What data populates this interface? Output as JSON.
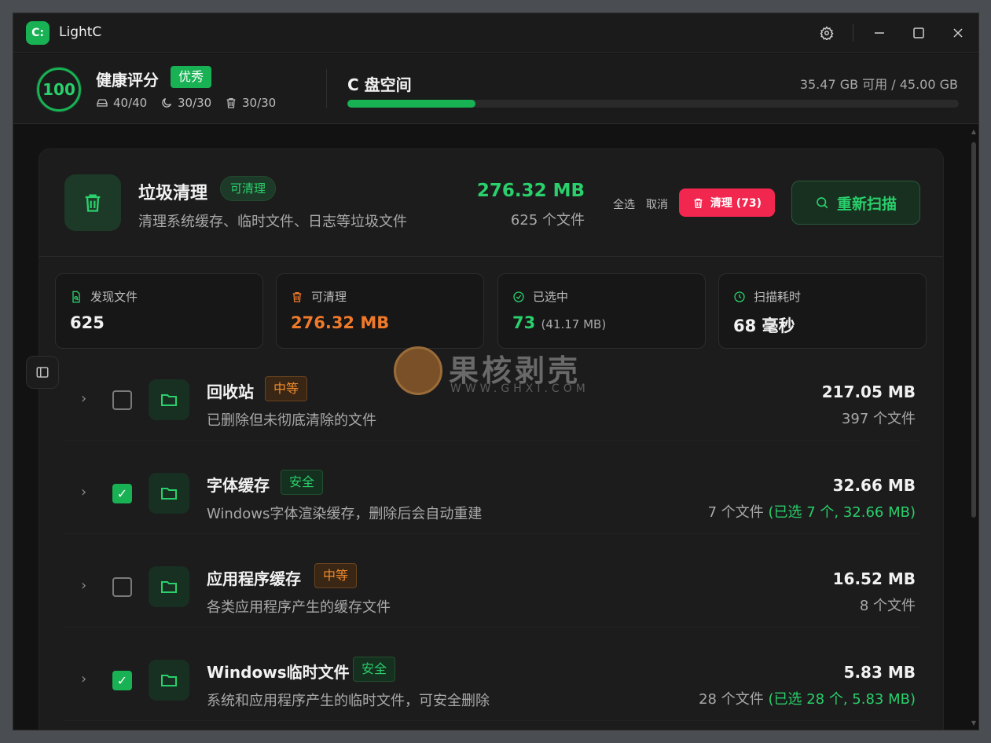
{
  "app": {
    "logo": "C:",
    "title": "LightC"
  },
  "titlebar": {
    "settings_icon": "gear-icon",
    "minimize_icon": "minimize-icon",
    "maximize_icon": "maximize-icon",
    "close_icon": "close-icon"
  },
  "header": {
    "score": "100",
    "health_title": "健康评分",
    "health_badge": "优秀",
    "stats": [
      {
        "icon": "drive-icon",
        "value": "40/40"
      },
      {
        "icon": "moon-icon",
        "value": "30/30"
      },
      {
        "icon": "trash-icon",
        "value": "30/30"
      }
    ],
    "disk_title": "C 盘空间",
    "disk_info": "35.47 GB 可用 / 45.00 GB",
    "disk_used_fraction": 0.21
  },
  "card": {
    "title": "垃圾清理",
    "badge": "可清理",
    "desc": "清理系统缓存、临时文件、日志等垃圾文件",
    "size": "276.32 MB",
    "count": "625 个文件",
    "select_all": "全选",
    "cancel": "取消",
    "clean_label": "清理 (73)",
    "rescan_label": "重新扫描"
  },
  "stats": [
    {
      "icon": "file-search-icon",
      "label": "发现文件",
      "value": "625",
      "sub": "",
      "color": "#f2f2f2"
    },
    {
      "icon": "trash-icon",
      "label": "可清理",
      "value": "276.32 MB",
      "sub": "",
      "color": "#f07a2a"
    },
    {
      "icon": "check-circle-icon",
      "label": "已选中",
      "value": "73",
      "sub": "(41.17 MB)",
      "color": "#29d06b"
    },
    {
      "icon": "clock-icon",
      "label": "扫描耗时",
      "value": "68 毫秒",
      "sub": "",
      "color": "#f2f2f2"
    }
  ],
  "watermark": {
    "text": "果核剥壳",
    "sub": "WWW.GHXI.COM"
  },
  "rows": [
    {
      "name": "回收站",
      "tag": "中等",
      "tag_type": "mid",
      "desc": "已删除但未彻底清除的文件",
      "size": "217.05 MB",
      "count": "397 个文件",
      "selected": "",
      "checked": false
    },
    {
      "name": "字体缓存",
      "tag": "安全",
      "tag_type": "safe",
      "desc": "Windows字体渲染缓存，删除后会自动重建",
      "size": "32.66 MB",
      "count": "7 个文件",
      "selected": "(已选 7 个, 32.66 MB)",
      "checked": true
    },
    {
      "name": "应用程序缓存",
      "tag": "中等",
      "tag_type": "mid",
      "desc": "各类应用程序产生的缓存文件",
      "size": "16.52 MB",
      "count": "8 个文件",
      "selected": "",
      "checked": false
    },
    {
      "name": "Windows临时文件",
      "tag": "安全",
      "tag_type": "safe",
      "desc": "系统和应用程序产生的临时文件，可安全删除",
      "size": "5.83 MB",
      "count": "28 个文件",
      "selected": "(已选 28 个, 5.83 MB)",
      "checked": true
    }
  ]
}
